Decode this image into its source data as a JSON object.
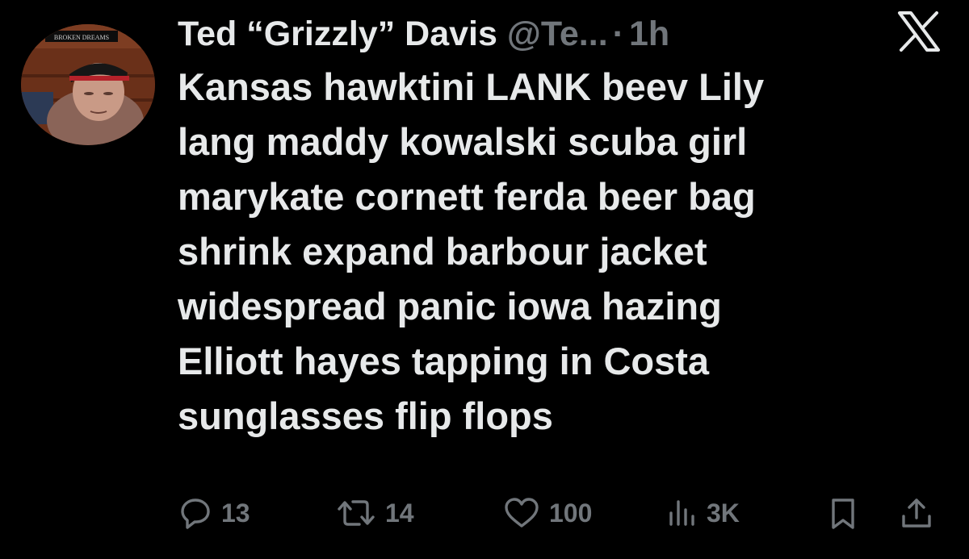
{
  "author": {
    "display_name": "Ted “Grizzly” Davis",
    "handle": "@Te...",
    "separator": "·",
    "time": "1h",
    "avatar_sign_text": "BROKEN DREAMS"
  },
  "tweet": {
    "lines": [
      "Kansas hawktini LANK beev Lily",
      "lang maddy kowalski scuba girl",
      "marykate cornett ferda beer bag",
      "shrink expand barbour jacket",
      "widespread panic iowa hazing",
      "Elliott hayes tapping in Costa",
      "sunglasses flip flops"
    ]
  },
  "actions": {
    "replies": "13",
    "retweets": "14",
    "likes": "100",
    "views": "3K"
  },
  "icons": {
    "close": "x-logo-icon",
    "reply": "reply-icon",
    "retweet": "retweet-icon",
    "like": "heart-icon",
    "views": "views-chart-icon",
    "bookmark": "bookmark-icon",
    "share": "share-icon"
  },
  "colors": {
    "background": "#000000",
    "text_primary": "#e7e9ea",
    "text_secondary": "#71767b"
  }
}
